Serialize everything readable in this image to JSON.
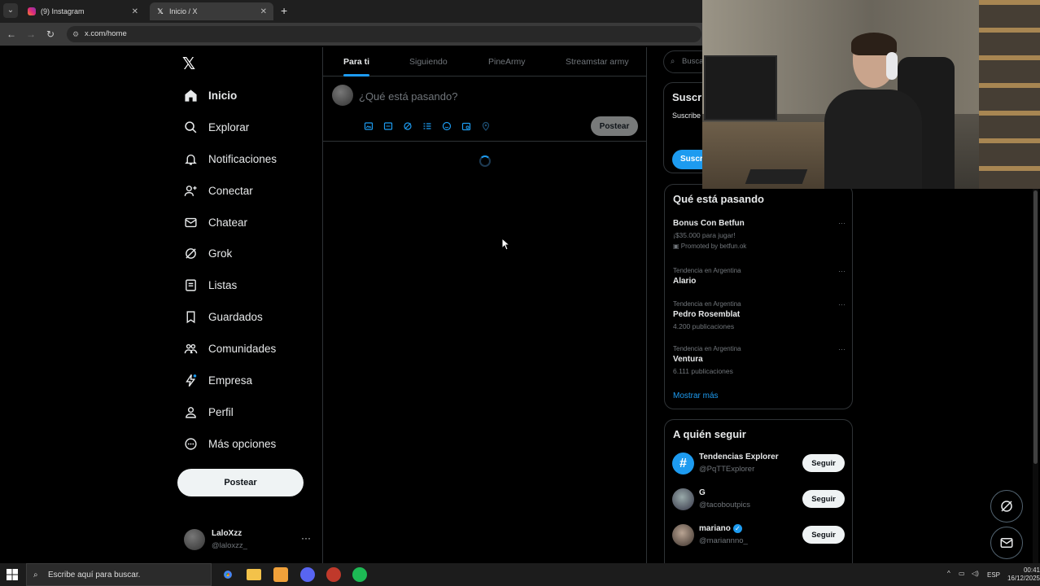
{
  "browser": {
    "tabs": [
      {
        "title": "(9) Instagram",
        "icon": "instagram-icon"
      },
      {
        "title": "Inicio / X",
        "icon": "x-logo-icon"
      }
    ],
    "url": "x.com/home"
  },
  "sidebar": {
    "logo": "𝕏",
    "items": [
      {
        "label": "Inicio",
        "icon": "home-icon"
      },
      {
        "label": "Explorar",
        "icon": "search-icon"
      },
      {
        "label": "Notificaciones",
        "icon": "bell-icon"
      },
      {
        "label": "Conectar",
        "icon": "add-person-icon"
      },
      {
        "label": "Chatear",
        "icon": "envelope-icon"
      },
      {
        "label": "Grok",
        "icon": "grok-icon"
      },
      {
        "label": "Listas",
        "icon": "list-icon"
      },
      {
        "label": "Guardados",
        "icon": "bookmark-icon"
      },
      {
        "label": "Comunidades",
        "icon": "communities-icon"
      },
      {
        "label": "Empresa",
        "icon": "lightning-icon"
      },
      {
        "label": "Perfil",
        "icon": "person-icon"
      },
      {
        "label": "Más opciones",
        "icon": "more-circle-icon"
      }
    ],
    "post_button": "Postear",
    "profile": {
      "name": "LaloXzz",
      "handle": "@laloxzz_",
      "more": "···"
    }
  },
  "feed": {
    "tabs": [
      "Para ti",
      "Siguiendo",
      "PineArmy",
      "Streamstar army"
    ],
    "composer": {
      "placeholder": "¿Qué está pasando?",
      "post_button": "Postear"
    }
  },
  "right": {
    "search_placeholder": "Buscar",
    "premium": {
      "title": "Suscri",
      "desc": "Suscribe y, si eres ingresos",
      "button": "Suscr"
    },
    "trends": {
      "title": "Qué está pasando",
      "items": [
        {
          "meta": "",
          "name": "Bonus Con Betfun",
          "sub": "¡$35.000 para jugar!",
          "promo": "Promoted by betfun.ok"
        },
        {
          "meta": "Tendencia en Argentina",
          "name": "Alario",
          "sub": "",
          "promo": ""
        },
        {
          "meta": "Tendencia en Argentina",
          "name": "Pedro Rosemblat",
          "sub": "4.200 publicaciones",
          "promo": ""
        },
        {
          "meta": "Tendencia en Argentina",
          "name": "Ventura",
          "sub": "6.111 publicaciones",
          "promo": ""
        }
      ],
      "more": "···",
      "show_more": "Mostrar más"
    },
    "follow": {
      "title": "A quién seguir",
      "items": [
        {
          "name": "Tendencias Explorer",
          "handle": "@PqTTExplorer",
          "button": "Seguir"
        },
        {
          "name": "G",
          "handle": "@tacoboutpics",
          "button": "Seguir"
        },
        {
          "name": "mariano",
          "handle": "@mariannno_",
          "button": "Seguir"
        }
      ]
    }
  },
  "taskbar": {
    "search_placeholder": "Escribe aquí para buscar.",
    "lang": "ESP",
    "time": "00:41",
    "date": "16/12/2025"
  },
  "colors": {
    "accent": "#1d9bf0",
    "background": "#000000",
    "border": "#2f3336",
    "muted": "#71767b"
  }
}
